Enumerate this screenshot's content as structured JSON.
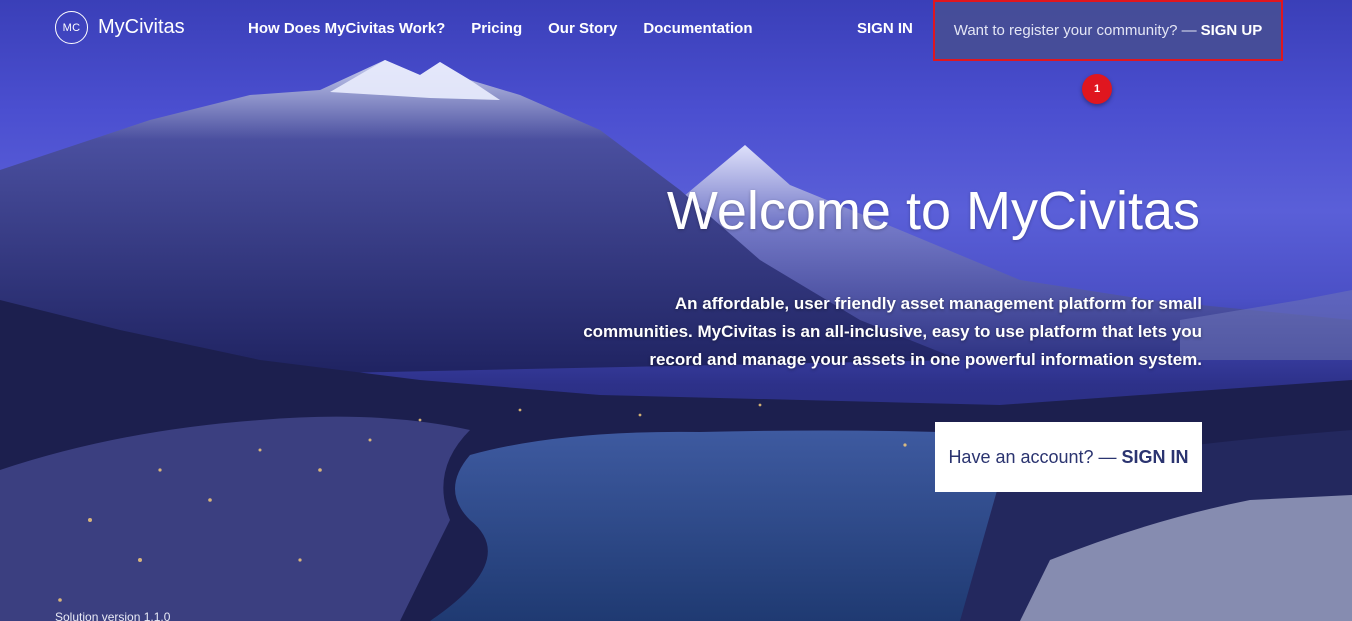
{
  "brand": {
    "logo_text": "MC",
    "name": "MyCivitas"
  },
  "nav": {
    "links": [
      "How Does MyCivitas Work?",
      "Pricing",
      "Our Story",
      "Documentation"
    ],
    "sign_in": "SIGN IN"
  },
  "register": {
    "text": "Want to register your community? —",
    "cta": "SIGN UP",
    "highlight_color": "#e0161f"
  },
  "annotation": {
    "badge_number": "1"
  },
  "hero": {
    "title": "Welcome to MyCivitas",
    "description": "An affordable, user friendly asset management platform for small communities. MyCivitas is an all-inclusive, easy to use platform that lets you record and manage your assets in one powerful information system."
  },
  "account": {
    "text": "Have an account? —",
    "cta": "SIGN IN"
  },
  "footer": {
    "version": "Solution version 1.1.0"
  }
}
